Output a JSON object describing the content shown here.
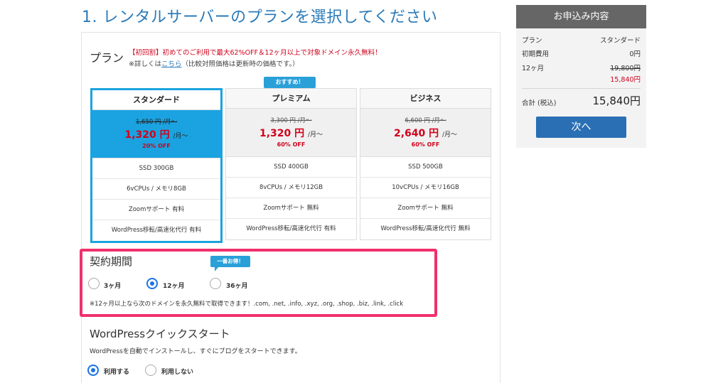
{
  "heading": "1. レンタルサーバーのプランを選択してください",
  "plan_section": {
    "label": "プラン",
    "promo": "【初回割】初めてのご利用で最大62%OFF＆12ヶ月以上で対象ドメイン永久無料！",
    "note_prefix": "※詳しくは",
    "note_link": "こちら",
    "note_suffix": "（比較対照価格は更新時の価格です。）",
    "recommend_badge": "おすすめ！",
    "plans": [
      {
        "name": "スタンダード",
        "old_price": "1,650 円 /月〜",
        "new_price": "1,320 円",
        "unit": "/月〜",
        "discount": "20% OFF",
        "specs": [
          "SSD 300GB",
          "6vCPUs / メモリ8GB",
          "Zoomサポート 有料",
          "WordPress移転/高速化代行 有料"
        ],
        "selected": true
      },
      {
        "name": "プレミアム",
        "old_price": "3,300 円 /月〜",
        "new_price": "1,320 円",
        "unit": "/月〜",
        "discount": "60% OFF",
        "specs": [
          "SSD 400GB",
          "8vCPUs / メモリ12GB",
          "Zoomサポート 無料",
          "WordPress移転/高速化代行 有料"
        ],
        "selected": false
      },
      {
        "name": "ビジネス",
        "old_price": "6,600 円 /月〜",
        "new_price": "2,640 円",
        "unit": "/月〜",
        "discount": "60% OFF",
        "specs": [
          "SSD 500GB",
          "10vCPUs / メモリ16GB",
          "Zoomサポート 無料",
          "WordPress移転/高速化代行 無料"
        ],
        "selected": false
      }
    ]
  },
  "contract": {
    "title": "契約期間",
    "best_badge": "一番お得！",
    "options": [
      {
        "label": "3ヶ月",
        "selected": false
      },
      {
        "label": "12ヶ月",
        "selected": true
      },
      {
        "label": "36ヶ月",
        "selected": false
      }
    ],
    "note": "※12ヶ月以上なら次のドメインを永久無料で取得できます！.com, .net, .info, .xyz, .org, .shop, .biz, .link, .click"
  },
  "wordpress": {
    "title": "WordPressクイックスタート",
    "desc": "WordPressを自動でインストールし、すぐにブログをスタートできます。",
    "options": [
      {
        "label": "利用する",
        "selected": true
      },
      {
        "label": "利用しない",
        "selected": false
      }
    ]
  },
  "summary": {
    "title": "お申込み内容",
    "plan_label": "プラン",
    "plan_value": "スタンダード",
    "initial_label": "初期費用",
    "initial_value": "0円",
    "term_label": "12ヶ月",
    "term_old": "19,800円",
    "term_new": "15,840円",
    "total_label": "合計 (税込)",
    "total_value": "15,840円",
    "next_button": "次へ"
  },
  "colors": {
    "accent": "#1aa3e0",
    "heading": "#2a7ab8",
    "highlight_border": "#f0306d",
    "price_red": "#d0021b",
    "button": "#2a6fb4"
  }
}
